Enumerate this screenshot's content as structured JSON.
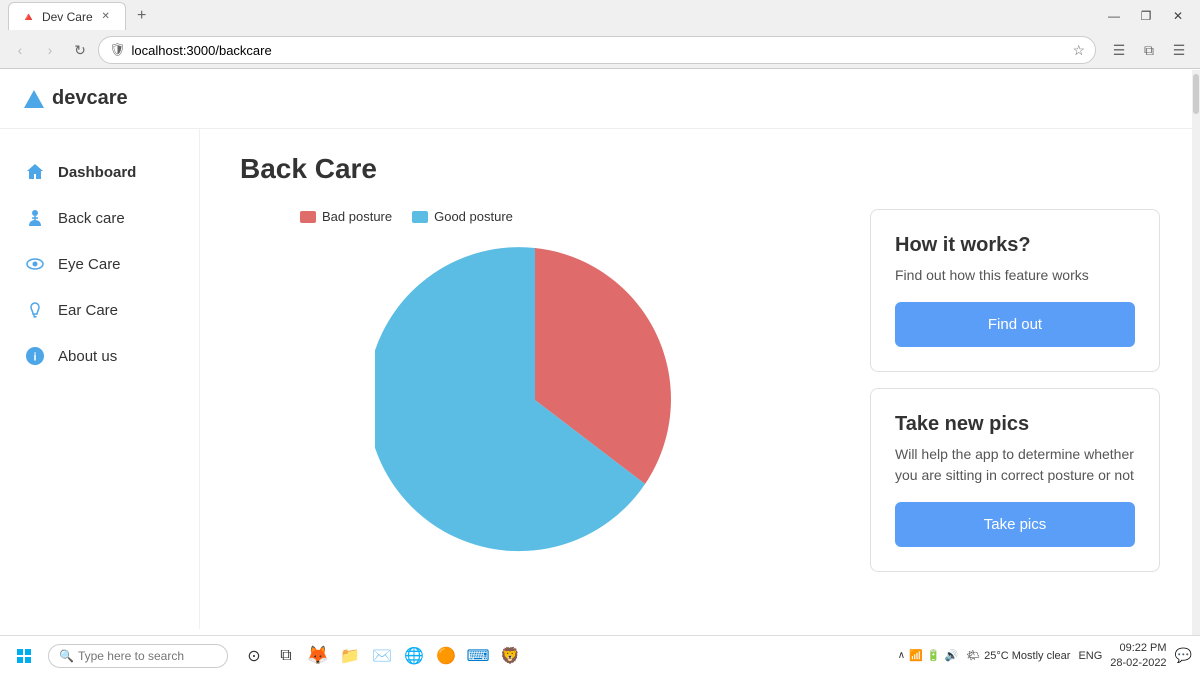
{
  "browser": {
    "tab_title": "Dev Care",
    "url": "localhost:3000/backcare",
    "nav_back": "‹",
    "nav_forward": "›",
    "nav_refresh": "↻",
    "new_tab_label": "+",
    "win_minimize": "—",
    "win_restore": "❐",
    "win_close": "✕"
  },
  "app": {
    "logo_text": "devcare",
    "page_title": "Back Care"
  },
  "sidebar": {
    "items": [
      {
        "id": "dashboard",
        "label": "Dashboard",
        "active": true,
        "icon": "home"
      },
      {
        "id": "backcare",
        "label": "Back care",
        "active": false,
        "icon": "person"
      },
      {
        "id": "eyecare",
        "label": "Eye Care",
        "active": false,
        "icon": "eye"
      },
      {
        "id": "earcare",
        "label": "Ear Care",
        "active": false,
        "icon": "ear"
      },
      {
        "id": "about",
        "label": "About us",
        "active": false,
        "icon": "info"
      }
    ]
  },
  "chart": {
    "legend": [
      {
        "label": "Bad posture",
        "color": "#e06b6b"
      },
      {
        "label": "Good posture",
        "color": "#5bbde4"
      }
    ],
    "bad_posture_percent": 38,
    "good_posture_percent": 62
  },
  "cards": [
    {
      "id": "how-it-works",
      "title": "How it works?",
      "description": "Find out how this feature works",
      "button_label": "Find out"
    },
    {
      "id": "take-pics",
      "title": "Take new pics",
      "description": "Will help the app to determine whether you are sitting in correct posture or not",
      "button_label": "Take pics"
    }
  ],
  "taskbar": {
    "search_placeholder": "Type here to search",
    "weather": "25°C  Mostly clear",
    "time": "09:22 PM",
    "date": "28-02-2022",
    "lang": "ENG"
  },
  "colors": {
    "bad_posture": "#e06b6b",
    "good_posture": "#5bbde4",
    "accent_blue": "#5b9ef7",
    "logo_blue": "#4da6e8"
  }
}
